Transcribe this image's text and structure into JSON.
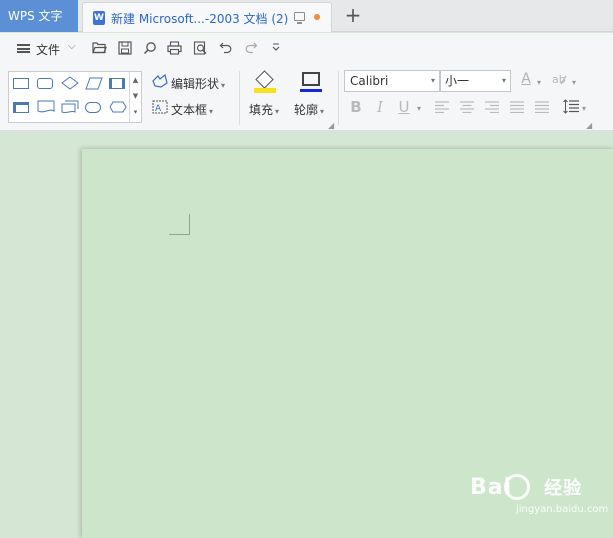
{
  "titlebar": {
    "app_tab": "WPS 文字",
    "doc_tab_title": "新建 Microsoft...-2003 文档 (2)",
    "doc_icon_letter": "W",
    "new_tab_symbol": "+"
  },
  "quickbar": {
    "file_label": "文件",
    "file_caret": "⌵"
  },
  "ribbon": {
    "edit_shape_label": "编辑形状",
    "text_box_label": "文本框",
    "fill_label": "填充",
    "outline_label": "轮廓",
    "font_name": "Calibri",
    "font_size": "小一",
    "bold_label": "B",
    "italic_label": "I",
    "underline_label": "U",
    "font_color_label": "A"
  },
  "watermark": {
    "logo_text": "Bai",
    "logo_text_2": "经验",
    "url": "jingyan.baidu.com"
  },
  "colors": {
    "app_tab": "#5b8fd6",
    "page_bg": "#cde6cb",
    "workspace_bg": "#d5e6d4",
    "fill_color": "#f7e01e",
    "outline_color": "#1627d8",
    "unsaved_dot": "#f08b36"
  }
}
